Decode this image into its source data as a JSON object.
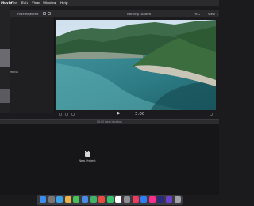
{
  "menubar": {
    "app": "Movie",
    "menus": [
      "File",
      "Edit",
      "View",
      "Window",
      "Help"
    ]
  },
  "toolbar": {
    "media_filter": "Hide Rejected ⌃",
    "status": "Nothing Loaded",
    "zoom": "Fit ⌄",
    "view_menu": "View ⌄"
  },
  "sidebar": {
    "label": "Media"
  },
  "viewer": {
    "timecode": "3:00"
  },
  "timeline": {
    "header": "00:00 total duration",
    "new_project_label": "New Project"
  },
  "dock": {
    "icons": [
      "finder-icon",
      "launchpad-icon",
      "safari-icon",
      "photos-icon",
      "messages-icon",
      "mail-icon",
      "maps-icon",
      "chrome-icon",
      "facetime-icon",
      "calendar-icon",
      "settings-icon",
      "music-icon",
      "app-store-icon",
      "xd-icon",
      "premiere-icon",
      "imovie-icon",
      "trash-icon"
    ],
    "colors": [
      "#3b8df0",
      "#777",
      "#3aa0e8",
      "#e8b34a",
      "#47c15a",
      "#4a8be8",
      "#3fb36c",
      "#e94b3c",
      "#39c16b",
      "#ffffff",
      "#8e8e93",
      "#f03a5c",
      "#2f7ef6",
      "#ff2d8a",
      "#2a2a7a",
      "#6c3fcf",
      "#9fa3a8"
    ]
  }
}
